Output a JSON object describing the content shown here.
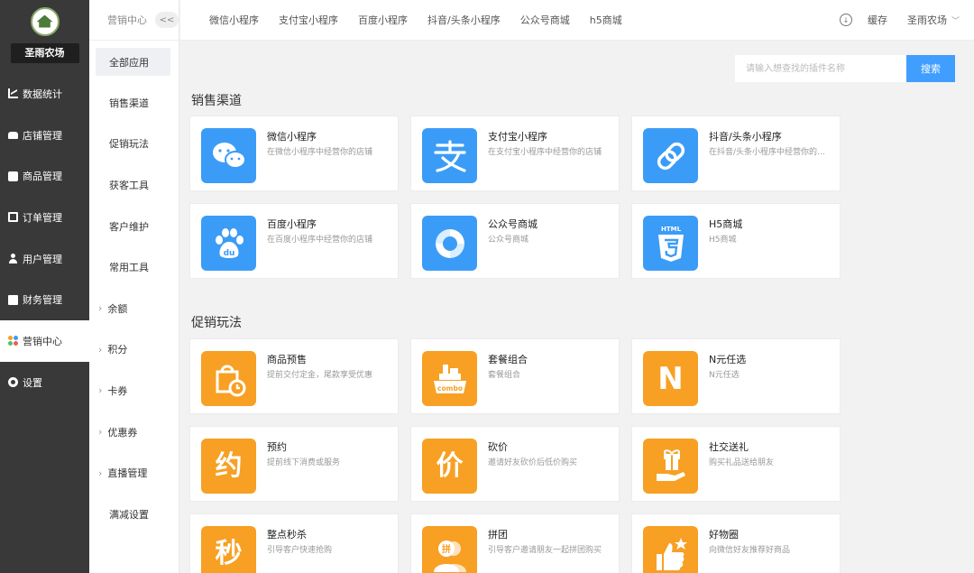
{
  "sidebar": {
    "shop_name": "圣雨农场",
    "items": [
      {
        "label": "数据统计",
        "icon": "chart-icon"
      },
      {
        "label": "店铺管理",
        "icon": "shop-icon"
      },
      {
        "label": "商品管理",
        "icon": "goods-icon"
      },
      {
        "label": "订单管理",
        "icon": "order-icon"
      },
      {
        "label": "用户管理",
        "icon": "user-icon"
      },
      {
        "label": "财务管理",
        "icon": "finance-icon"
      },
      {
        "label": "营销中心",
        "icon": "marketing-icon"
      },
      {
        "label": "设置",
        "icon": "gear-icon"
      }
    ]
  },
  "subnav": {
    "title": "营销中心",
    "collapse": "<<",
    "items": [
      "全部应用",
      "销售渠道",
      "促销玩法",
      "获客工具",
      "客户维护",
      "常用工具"
    ],
    "groups": [
      "余额",
      "积分",
      "卡券",
      "优惠券",
      "直播管理"
    ],
    "last": "满减设置"
  },
  "topbar": {
    "tabs": [
      "微信小程序",
      "支付宝小程序",
      "百度小程序",
      "抖音/头条小程序",
      "公众号商城",
      "h5商城"
    ],
    "cache": "缓存",
    "user": "圣雨农场"
  },
  "search": {
    "placeholder": "请输入想查找的插件名称",
    "button": "搜索"
  },
  "sections": {
    "sales": {
      "title": "销售渠道",
      "cards": [
        {
          "title": "微信小程序",
          "desc": "在微信小程序中经营你的店铺"
        },
        {
          "title": "支付宝小程序",
          "desc": "在支付宝小程序中经营你的店铺"
        },
        {
          "title": "抖音/头条小程序",
          "desc": "在抖音/头条小程序中经营你的店铺"
        },
        {
          "title": "百度小程序",
          "desc": "在百度小程序中经营你的店铺"
        },
        {
          "title": "公众号商城",
          "desc": "公众号商城"
        },
        {
          "title": "H5商城",
          "desc": "H5商城",
          "glyph": "HTML"
        }
      ]
    },
    "promo": {
      "title": "促销玩法",
      "cards": [
        {
          "title": "商品预售",
          "desc": "提前交付定金，尾款享受优惠"
        },
        {
          "title": "套餐组合",
          "desc": "套餐组合",
          "glyph": "combo"
        },
        {
          "title": "N元任选",
          "desc": "N元任选",
          "glyph": "N"
        },
        {
          "title": "预约",
          "desc": "提前线下消费或服务",
          "glyph": "约"
        },
        {
          "title": "砍价",
          "desc": "邀请好友砍价后低价购买",
          "glyph": "价"
        },
        {
          "title": "社交送礼",
          "desc": "购买礼品送给朋友"
        },
        {
          "title": "整点秒杀",
          "desc": "引导客户快速抢购",
          "glyph": "秒"
        },
        {
          "title": "拼团",
          "desc": "引导客户邀请朋友一起拼团购买",
          "glyph": "拼"
        },
        {
          "title": "好物圈",
          "desc": "向微信好友推荐好商品"
        }
      ]
    }
  },
  "colors": {
    "accent": "#409eff",
    "blue_icon": "#3b9cf7",
    "orange_icon": "#f7a023",
    "sidebar": "#393939"
  }
}
